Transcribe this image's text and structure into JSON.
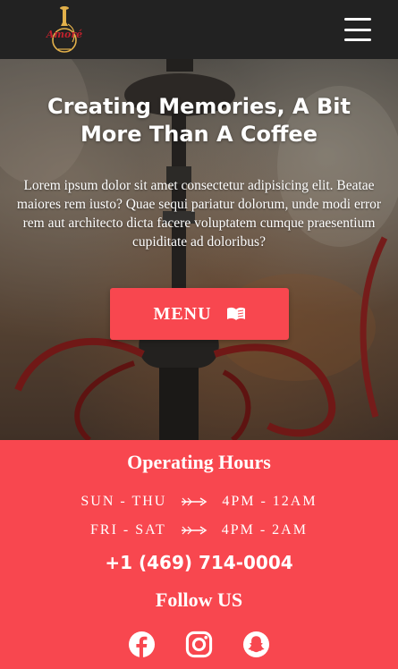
{
  "header": {
    "logo_text": "Amoré",
    "menu_icon": "hamburger-menu-icon"
  },
  "hero": {
    "title": "Creating Memories, A Bit More Than A Coffee",
    "text": "Lorem ipsum dolor sit amet consectetur adipisicing elit. Beatae maiores rem iusto? Quae sequi pariatur dolorum, unde modi error rem aut architecto dicta facere voluptatem cumque praesentium cupiditate ad doloribus?",
    "menu_button": {
      "label": "MENU",
      "icon": "book-icon"
    }
  },
  "hours": {
    "title": "Operating Hours",
    "rows": [
      {
        "days": "SUN - THU",
        "time": "4PM - 12AM"
      },
      {
        "days": "FRI - SAT",
        "time": "4PM - 2AM"
      }
    ]
  },
  "phone": "+1 (469) 714-0004",
  "follow": {
    "title": "Follow US",
    "links": [
      {
        "name": "facebook-icon"
      },
      {
        "name": "instagram-icon"
      },
      {
        "name": "snapchat-icon"
      }
    ]
  },
  "colors": {
    "accent": "#f8474f",
    "navbar": "#222222",
    "text": "#ffffff",
    "logo": "#c0222d"
  }
}
